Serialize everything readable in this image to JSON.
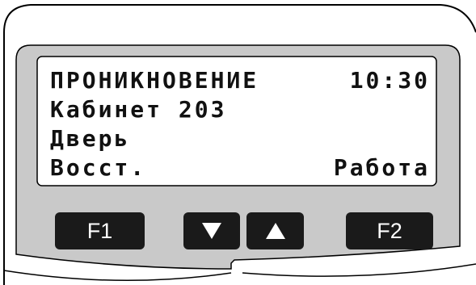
{
  "colors": {
    "bezel": "#c9c9c9",
    "lcd_background": "#ffffff",
    "text": "#111111",
    "key": "#1a1a1a"
  },
  "display": {
    "line1": {
      "left": "ПРОНИКНОВЕНИЕ",
      "right": "10:30"
    },
    "line2": {
      "left": "Кабинет 203",
      "right": ""
    },
    "line3": {
      "left": "Дверь",
      "right": ""
    },
    "line4": {
      "left": "Восст.",
      "right": "Работа"
    }
  },
  "keys": {
    "f1_label": "F1",
    "f2_label": "F2",
    "down_icon": "triangle-down",
    "up_icon": "triangle-up"
  }
}
